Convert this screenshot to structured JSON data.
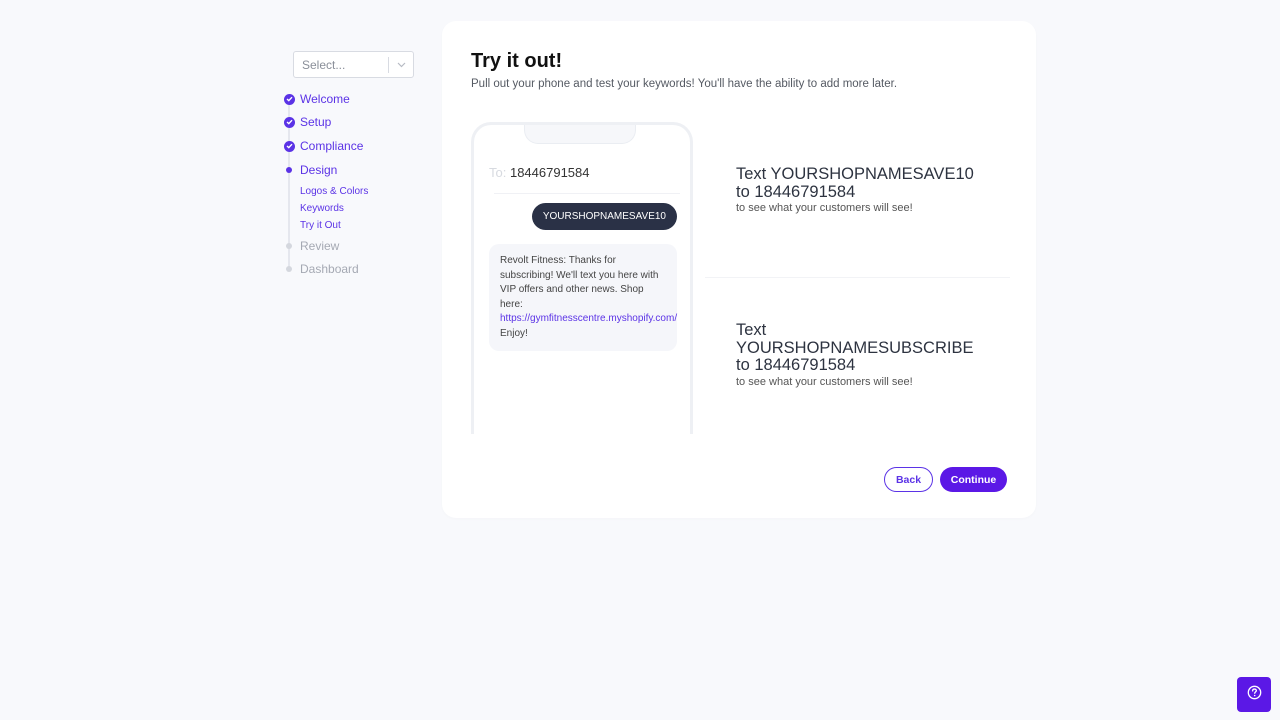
{
  "sidebar": {
    "select_placeholder": "Select...",
    "steps": [
      {
        "label": "Welcome",
        "status": "complete"
      },
      {
        "label": "Setup",
        "status": "complete"
      },
      {
        "label": "Compliance",
        "status": "complete"
      },
      {
        "label": "Design",
        "status": "current"
      },
      {
        "label": "Review",
        "status": "pending"
      },
      {
        "label": "Dashboard",
        "status": "pending"
      }
    ],
    "substeps": [
      "Logos & Colors",
      "Keywords",
      "Try it Out"
    ]
  },
  "main": {
    "title": "Try it out!",
    "subtitle": "Pull out your phone and test your keywords! You'll have the ability to add more later.",
    "phone": {
      "to_label": "To:",
      "to_number": "18446791584",
      "outgoing_message": "YOURSHOPNAMESAVE10",
      "incoming_message_text": "Revolt Fitness: Thanks for subscribing! We'll text you here with VIP offers and other news. Shop here:",
      "incoming_message_link": "https://gymfitnesscentre.myshopify.com/",
      "incoming_message_tail": "Enjoy!"
    },
    "instructions": [
      {
        "headline": "Text YOURSHOPNAMESAVE10 to 18446791584",
        "note": "to see what your customers will see!"
      },
      {
        "headline": "Text YOURSHOPNAMESUBSCRIBE to 18446791584",
        "note": "to see what your customers will see!"
      }
    ],
    "buttons": {
      "back": "Back",
      "continue": "Continue"
    }
  },
  "help_button": {
    "icon": "question-circle-icon"
  },
  "colors": {
    "accent": "#5b33e6",
    "primary_button": "#5b18e6",
    "outgoing_bubble": "#2a3146",
    "background": "#f8f9fc"
  }
}
